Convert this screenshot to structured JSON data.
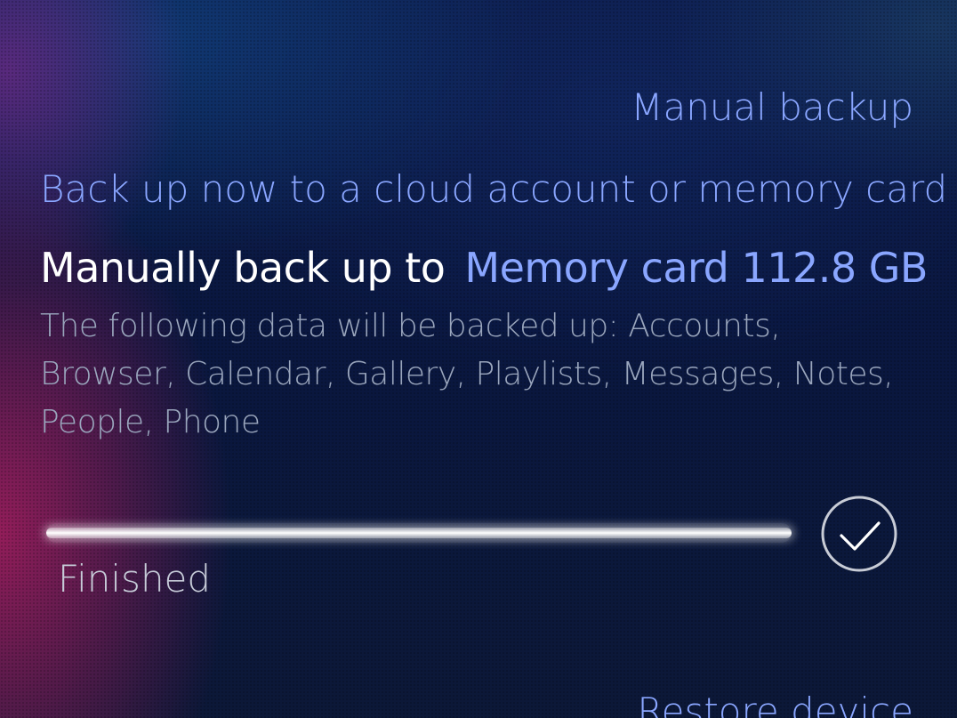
{
  "page": {
    "header": "Manual backup",
    "section_header": "Back up now to a cloud account or memory card"
  },
  "backup_target": {
    "label": "Manually back up to",
    "value": "Memory card 112.8 GB"
  },
  "description": "The following data will be backed up: Accounts, Browser, Calendar, Gallery, Playlists, Messages, Notes, People, Phone",
  "progress": {
    "value_percent": 100,
    "status": "Finished",
    "status_icon": "checkmark-circle-icon"
  },
  "bottom_link": "Restore device",
  "colors": {
    "highlight": "#8aa6ff",
    "primary_text": "#ffffff",
    "secondary_text": "#9aa6bd"
  }
}
